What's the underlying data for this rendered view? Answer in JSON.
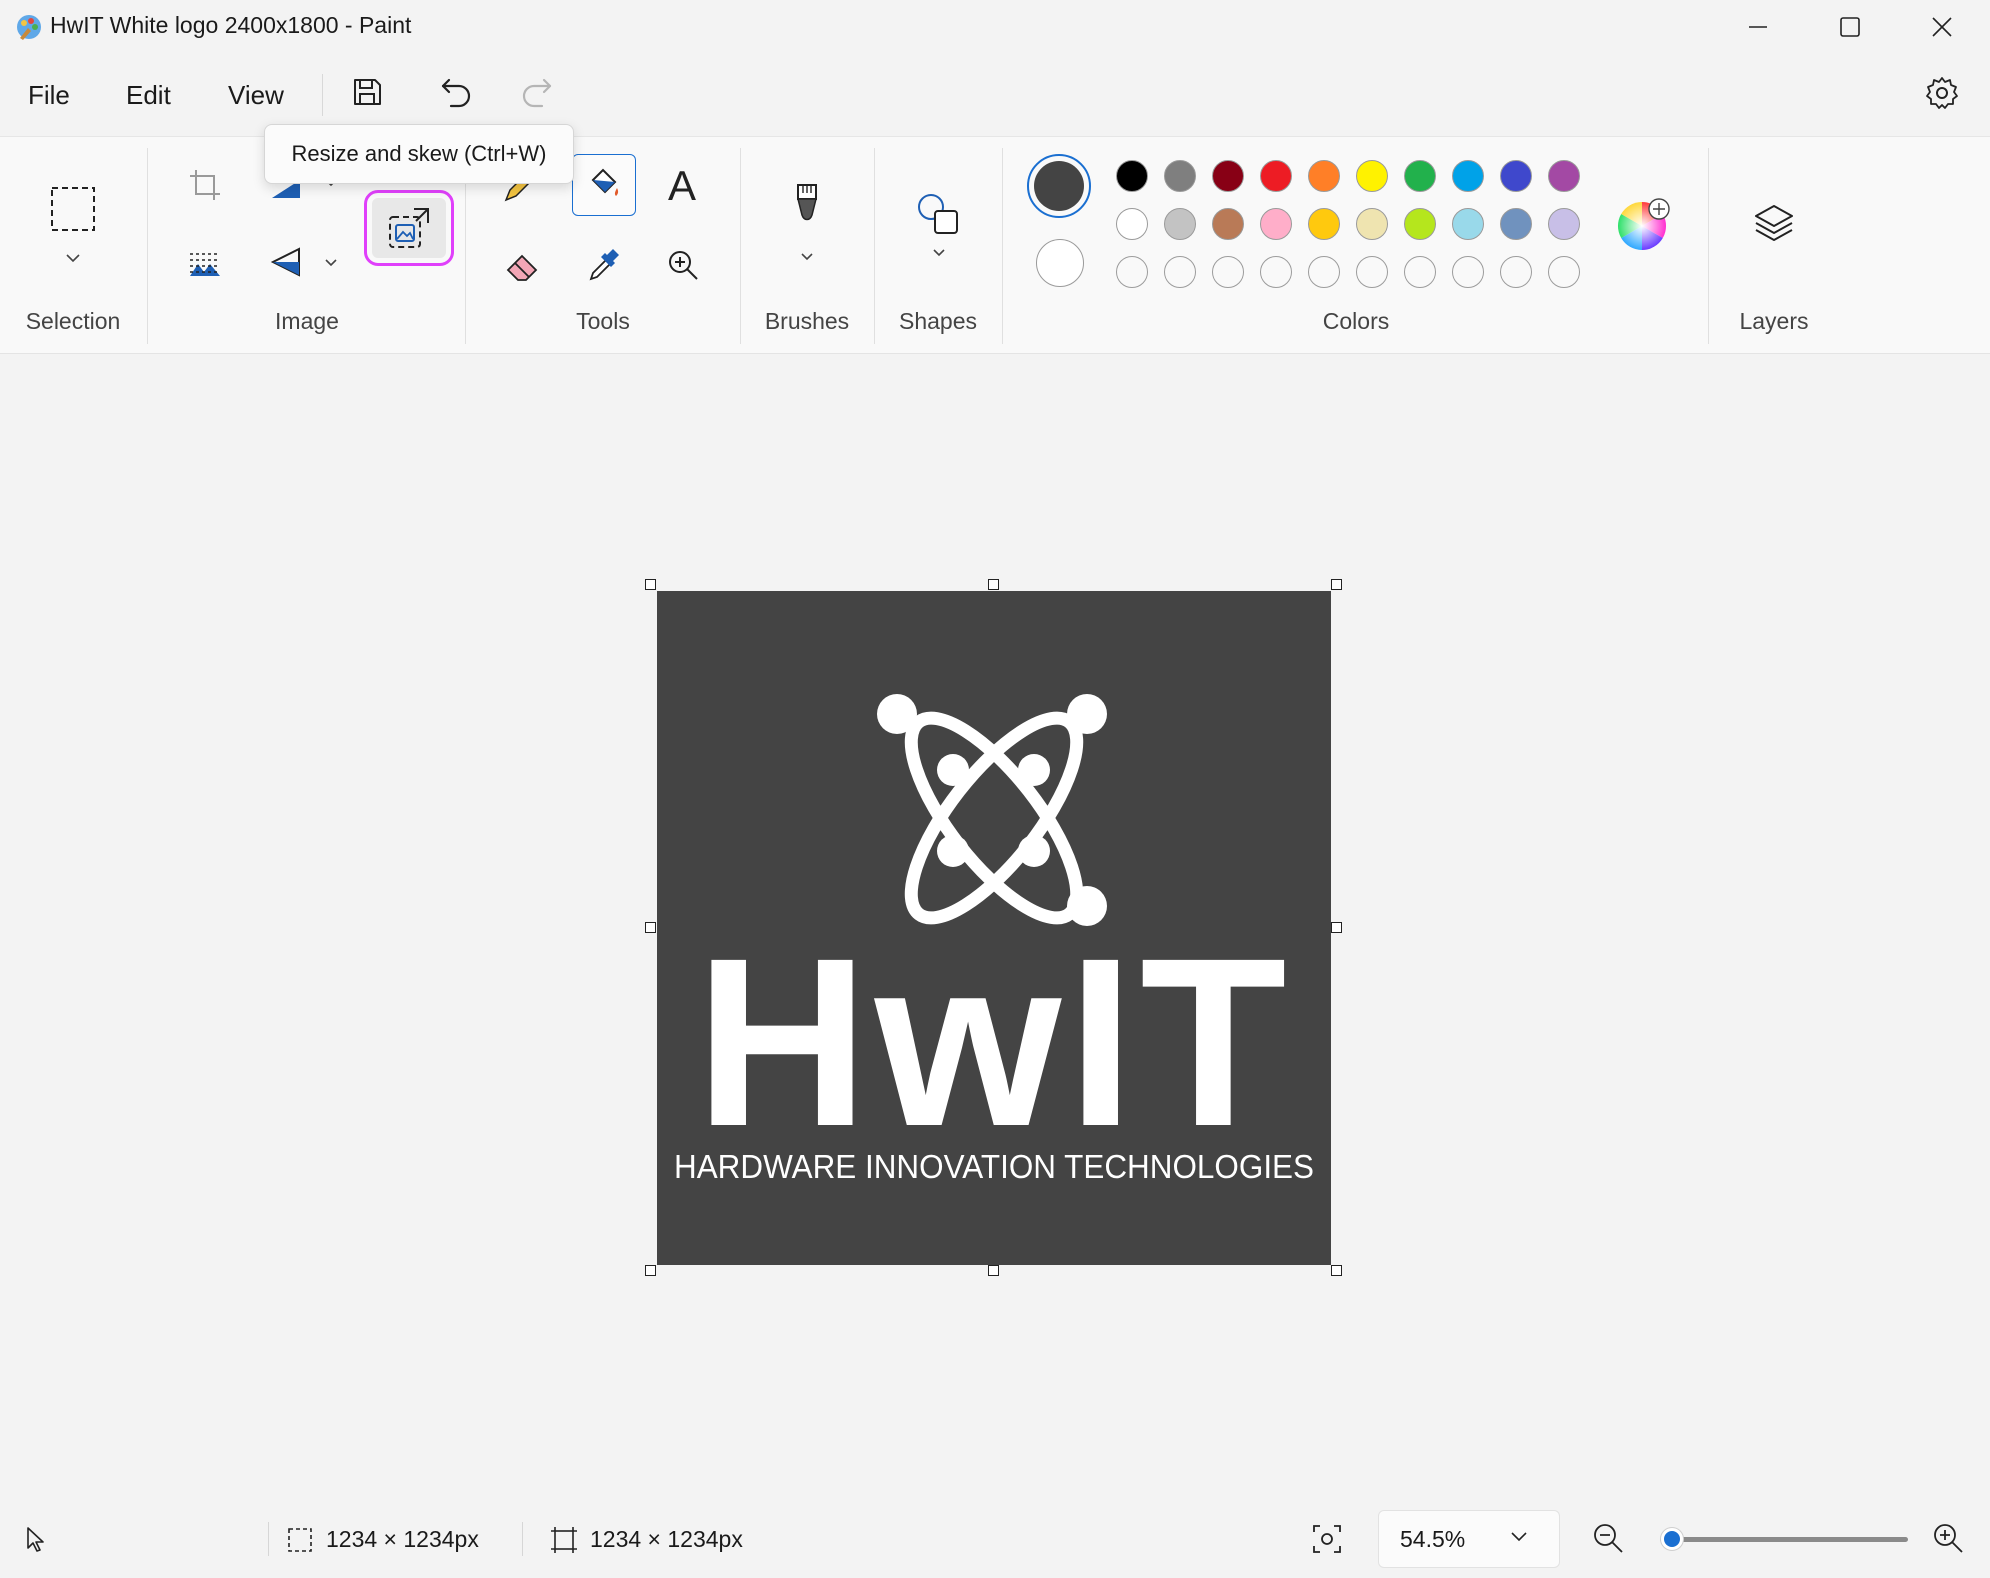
{
  "window": {
    "title": "HwIT White logo 2400x1800 - Paint"
  },
  "menu": {
    "file": "File",
    "edit": "Edit",
    "view": "View"
  },
  "tooltip": "Resize and skew (Ctrl+W)",
  "ribbon": {
    "groups": {
      "selection": "Selection",
      "image": "Image",
      "tools": "Tools",
      "brushes": "Brushes",
      "shapes": "Shapes",
      "colors": "Colors",
      "layers": "Layers"
    },
    "text_tool_glyph": "A",
    "active_tool": "fill",
    "highlighted_tool": "resize-and-skew"
  },
  "colors": {
    "primary": "#444444",
    "secondary": "#ffffff",
    "row1": [
      "#000000",
      "#7f7f7f",
      "#880015",
      "#ed1c24",
      "#ff7f27",
      "#fff200",
      "#22b14c",
      "#00a2e8",
      "#3f48cc",
      "#a349a4"
    ],
    "row2": [
      "#ffffff",
      "#c3c3c3",
      "#b97a57",
      "#ffaec9",
      "#ffc90e",
      "#efe4b0",
      "#b5e61d",
      "#99d9ea",
      "#7092be",
      "#c8bfe7"
    ],
    "custom_empty_count": 10,
    "accent": "#1a6fd1",
    "highlight": "#e040fb"
  },
  "canvas": {
    "background": "#444444",
    "logo_wordmark": "HwIT",
    "logo_tagline": "HARDWARE INNOVATION TECHNOLOGIES"
  },
  "status": {
    "selection_size": "1234 × 1234px",
    "canvas_size": "1234 × 1234px",
    "zoom": "54.5%",
    "zoom_slider_fraction": 0.05
  }
}
